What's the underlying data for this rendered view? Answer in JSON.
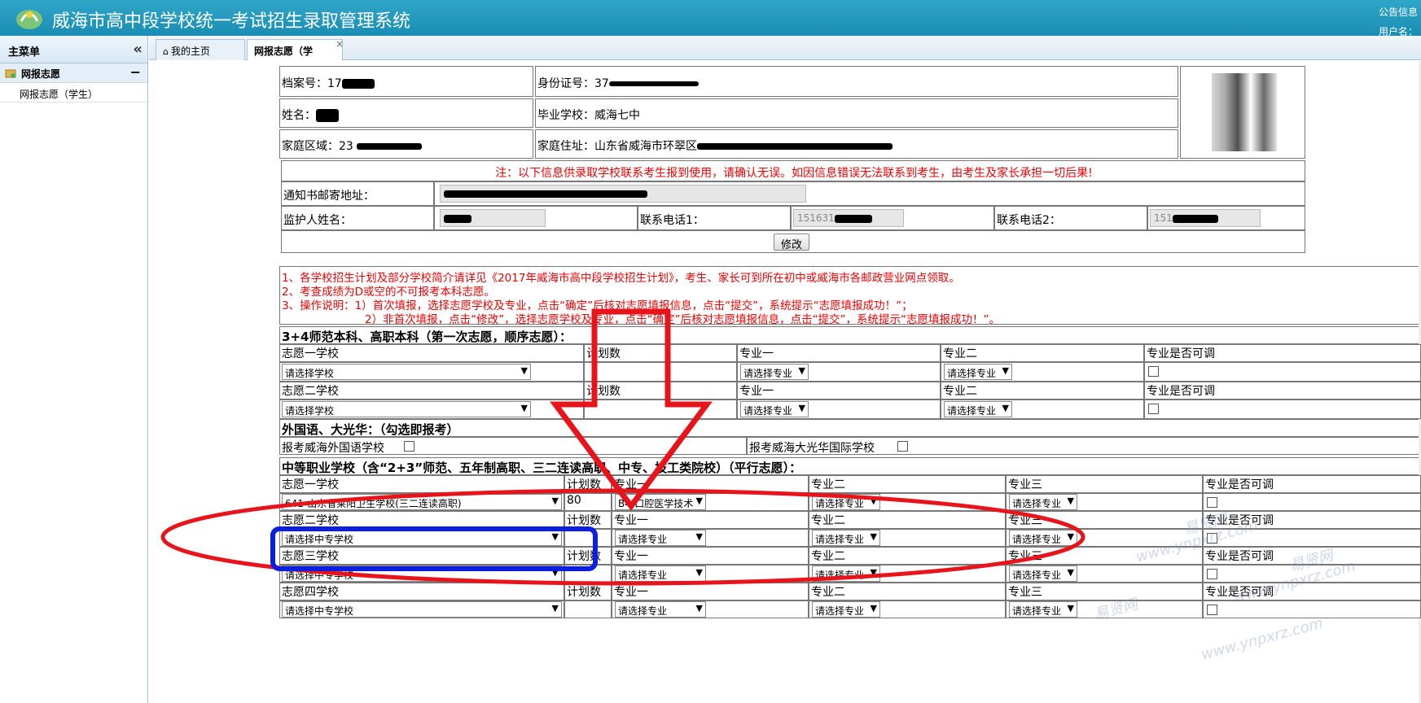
{
  "header": {
    "title": "威海市高中段学校统一考试招生录取管理系统",
    "notice": "公告信息",
    "user": "用户名："
  },
  "sidebar": {
    "title": "主菜单",
    "group_label": "网报志愿",
    "group_toggle": "−",
    "item_label": "网报志愿（学生）"
  },
  "tabs": {
    "home_label": "我的主页",
    "app_label": "网报志愿（学",
    "close": "×"
  },
  "student": {
    "file_no_label": "档案号：",
    "file_no_value": "17",
    "id_label": "身份证号：",
    "id_value": "37",
    "name_label": "姓名：",
    "school_label": "毕业学校：",
    "school_value": "威海七中",
    "region_label": "家庭区域：",
    "region_value": "23",
    "address_label": "家庭住址：",
    "address_value": "山东省威海市环翠区"
  },
  "contact": {
    "warning": "注：以下信息供录取学校联系考生报到使用，请确认无误。如因信息错误无法联系到考生，由考生及家长承担一切后果!",
    "mail_label": "通知书邮寄地址：",
    "guardian_label": "监护人姓名：",
    "phone1_label": "联系电话1：",
    "phone1_value": "151631",
    "phone2_label": "联系电话2：",
    "phone2_value": "151",
    "edit_button": "修改"
  },
  "notes": {
    "line1": "1、各学校招生计划及部分学校简介请详见《2017年威海市高中段学校招生计划》，考生、家长可到所在初中或威海市各邮政营业网点领取。",
    "line2": "2、考查成绩为D或空的不可报考本科志愿。",
    "line3": "3、操作说明：1）首次填报，选择志愿学校及专业，点击“确定”后核对志愿填报信息，点击“提交”，系统提示“志愿填报成功！”；",
    "line4": "2）非首次填报，点击“修改”，选择志愿学校及专业，点击“确定”后核对志愿填报信息，点击“提交”，系统提示“志愿填报成功！”。"
  },
  "section1": {
    "title": "3+4师范本科、高职本科（第一次志愿，顺序志愿）：",
    "rows": [
      {
        "school_label": "志愿一学校",
        "plan_label": "计划数",
        "major1_label": "专业一",
        "major2_label": "专业二",
        "adjust_label": "专业是否可调",
        "school_select": "请选择学校",
        "major1_select": "请选择专业",
        "major2_select": "请选择专业"
      },
      {
        "school_label": "志愿二学校",
        "plan_label": "计划数",
        "major1_label": "专业一",
        "major2_label": "专业二",
        "adjust_label": "专业是否可调",
        "school_select": "请选择学校",
        "major1_select": "请选择专业",
        "major2_select": "请选择专业"
      }
    ]
  },
  "section2": {
    "title": "外国语、大光华：（勾选即报考）",
    "option1": "报考威海外国语学校",
    "option2": "报考威海大光华国际学校"
  },
  "section3": {
    "title": "中等职业学校（含“2+3”师范、五年制高职、三二连读高职、中专、技工类院校）（平行志愿）：",
    "rows": [
      {
        "school_label": "志愿一学校",
        "plan_label": "计划数",
        "major1_label": "专业一",
        "major2_label": "专业二",
        "major3_label": "专业三",
        "adjust_label": "专业是否可调",
        "school_select": "641-山东省莱阳卫生学校(三二连读高职)",
        "plan_value": "80",
        "major1_select": "B4-口腔医学技术",
        "major2_select": "请选择专业",
        "major3_select": "请选择专业"
      },
      {
        "school_label": "志愿二学校",
        "plan_label": "计划数",
        "major1_label": "专业一",
        "major2_label": "专业二",
        "major3_label": "专业三",
        "adjust_label": "专业是否可调",
        "school_select": "请选择中专学校",
        "plan_value": "",
        "major1_select": "请选择专业",
        "major2_select": "请选择专业",
        "major3_select": "请选择专业"
      },
      {
        "school_label": "志愿三学校",
        "plan_label": "计划数",
        "major1_label": "专业一",
        "major2_label": "专业二",
        "major3_label": "专业三",
        "adjust_label": "专业是否可调",
        "school_select": "请选择中专学校",
        "plan_value": "",
        "major1_select": "请选择专业",
        "major2_select": "请选择专业",
        "major3_select": "请选择专业"
      },
      {
        "school_label": "志愿四学校",
        "plan_label": "计划数",
        "major1_label": "专业一",
        "major2_label": "专业二",
        "major3_label": "专业三",
        "adjust_label": "专业是否可调",
        "school_select": "请选择中专学校",
        "plan_value": "",
        "major1_select": "请选择专业",
        "major2_select": "请选择专业",
        "major3_select": "请选择专业"
      }
    ]
  },
  "watermarks": [
    "易贤网",
    "www.ynpxrz.com",
    "易贤网",
    "www.ynpxrz.com",
    "易贤网",
    "www.ynpxrz.com"
  ],
  "colors": {
    "header_bg": "#1b8db3",
    "warning_red": "#e00000",
    "annotation_red": "#e8141b",
    "annotation_blue": "#0b1fe0"
  }
}
